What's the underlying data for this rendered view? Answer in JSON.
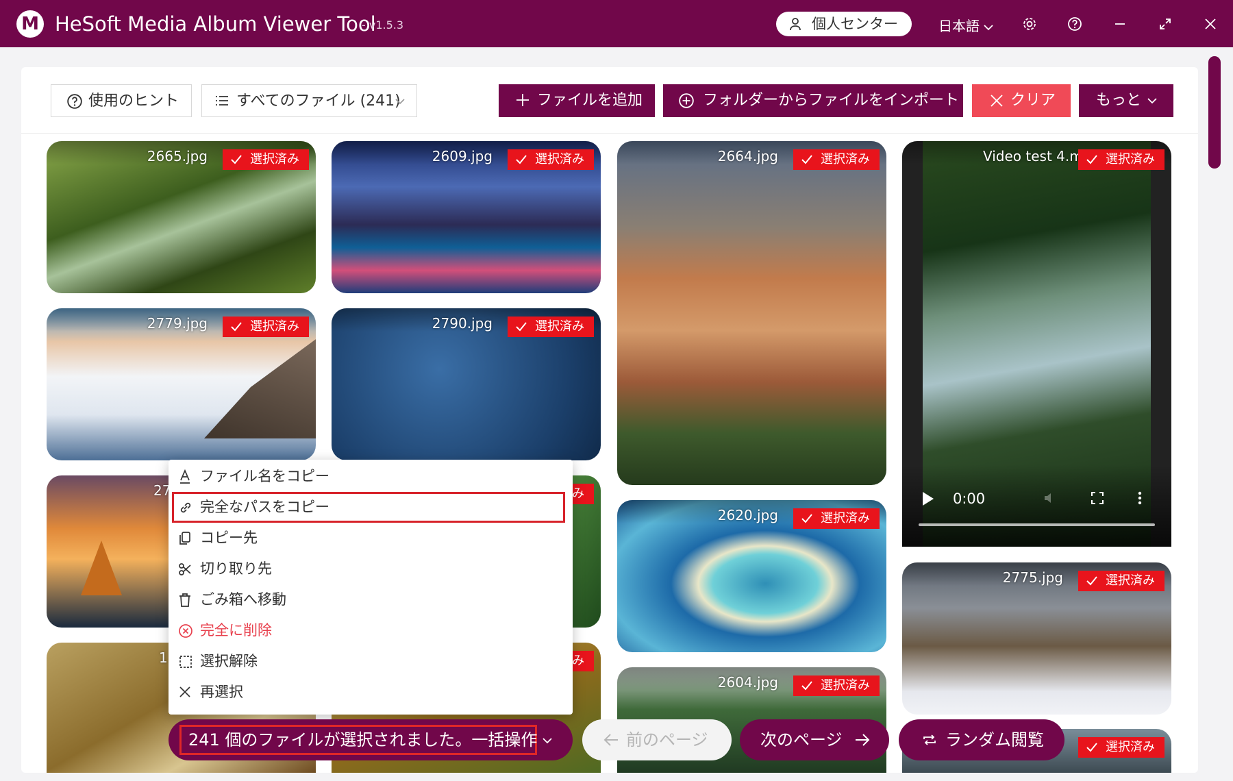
{
  "app": {
    "logo_letter": "M",
    "title": "HeSoft Media Album Viewer Tool",
    "version": "- v1.5.3",
    "user_center": "個人センター",
    "language": "日本語"
  },
  "colors": {
    "brand": "#71074a",
    "danger": "#f04a57",
    "badge": "#e8141c"
  },
  "toolbar": {
    "tips": "使用のヒント",
    "filter": "すべてのファイル (241)",
    "add_files": "ファイルを追加",
    "import_folder": "フォルダーからファイルをインポート",
    "clear": "クリア",
    "more": "もっと"
  },
  "selected_badge": "選択済み",
  "files": [
    {
      "name": "2665.jpg"
    },
    {
      "name": "2609.jpg"
    },
    {
      "name": "2664.jpg"
    },
    {
      "name": "Video test 4.mp4",
      "shown": "Video test 4.mp"
    },
    {
      "name": "2779.jpg"
    },
    {
      "name": "2790.jpg"
    },
    {
      "name": "27",
      "partial": true
    },
    {
      "name": "2620.jpg"
    },
    {
      "name": "2775.jpg"
    },
    {
      "name": "1",
      "partial": true
    },
    {
      "name": "2604.jpg"
    }
  ],
  "video": {
    "time": "0:00"
  },
  "context_menu": [
    {
      "label": "ファイル名をコピー",
      "icon": "text-a-icon"
    },
    {
      "label": "完全なパスをコピー",
      "icon": "link-icon",
      "highlighted": true
    },
    {
      "label": "コピー先",
      "icon": "copy-icon"
    },
    {
      "label": "切り取り先",
      "icon": "scissors-icon"
    },
    {
      "label": "ごみ箱へ移動",
      "icon": "trash-icon"
    },
    {
      "label": "完全に削除",
      "icon": "delete-circle-icon",
      "danger": true
    },
    {
      "label": "選択解除",
      "icon": "deselect-icon"
    },
    {
      "label": "再選択",
      "icon": "close-icon"
    }
  ],
  "bottom": {
    "batch": "241 個のファイルが選択されました。一括操作",
    "prev": "前のページ",
    "next": "次のページ",
    "random": "ランダム閲覧"
  }
}
